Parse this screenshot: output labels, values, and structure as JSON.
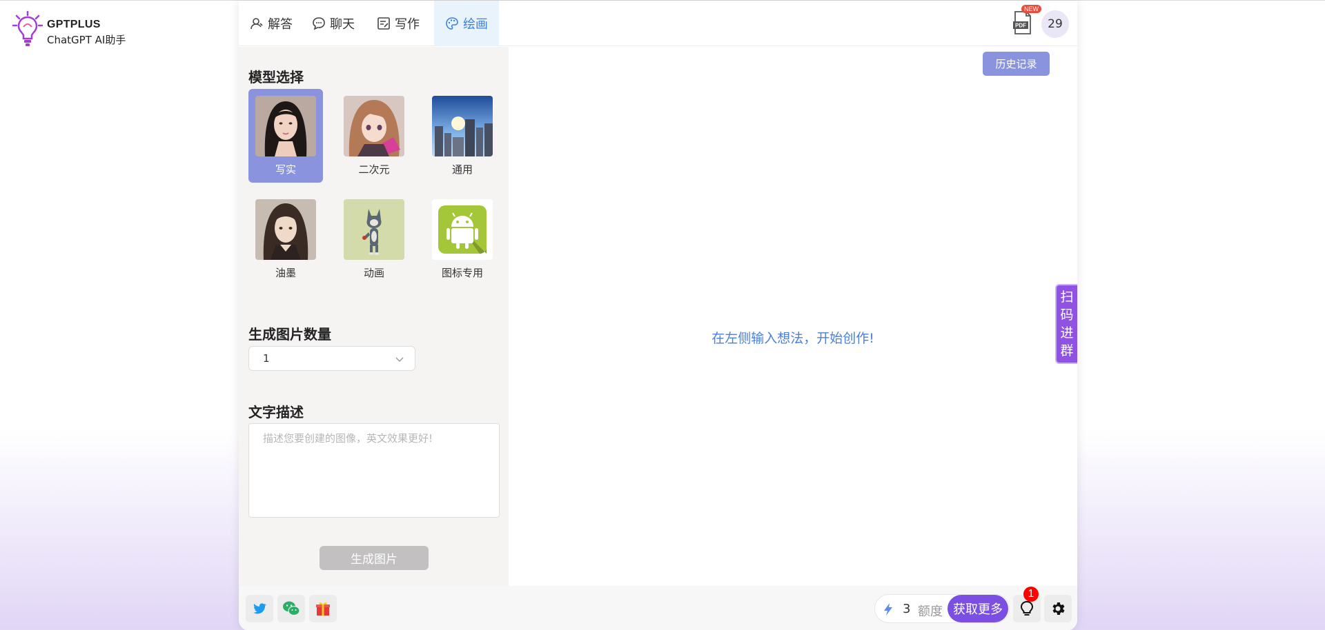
{
  "brand": {
    "name": "GPTPLUS",
    "subtitle": "ChatGPT AI助手"
  },
  "tabs": [
    {
      "label": "解答",
      "icon": "user-question-icon"
    },
    {
      "label": "聊天",
      "icon": "chat-bubble-icon"
    },
    {
      "label": "写作",
      "icon": "edit-note-icon"
    },
    {
      "label": "绘画",
      "icon": "palette-icon",
      "active": true
    }
  ],
  "topbar": {
    "pdf_badge": "NEW",
    "pdf_icon": "pdf-file-icon",
    "count": "29"
  },
  "models": {
    "title": "模型选择",
    "items": [
      {
        "label": "写实",
        "selected": true
      },
      {
        "label": "二次元"
      },
      {
        "label": "通用"
      },
      {
        "label": "油墨"
      },
      {
        "label": "动画"
      },
      {
        "label": "图标专用"
      }
    ]
  },
  "quantity": {
    "title": "生成图片数量",
    "value": "1"
  },
  "prompt": {
    "title": "文字描述",
    "placeholder": "描述您要创建的图像，英文效果更好!"
  },
  "generate_label": "生成图片",
  "canvas": {
    "history_label": "历史记录",
    "hint": "在左侧输入想法，开始创作!",
    "scan_tab": "扫码进群"
  },
  "footer": {
    "credit_value": "3",
    "credit_unit": "额度",
    "more_label": "获取更多",
    "notification_count": "1"
  },
  "colors": {
    "accent": "#8a93dd",
    "active_tab_bg": "#e9f3fb",
    "active_tab_text": "#3d7fe0",
    "hint_text": "#4a7fe0",
    "purple": "#7b4fe1"
  }
}
